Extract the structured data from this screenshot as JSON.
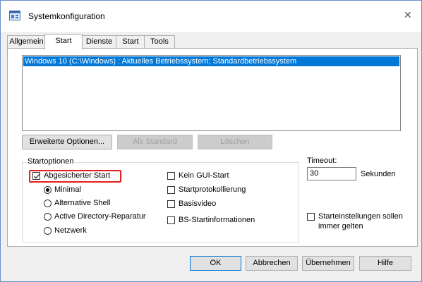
{
  "window": {
    "title": "Systemkonfiguration"
  },
  "icons": {
    "app": "msconfig-icon",
    "close": "close-icon"
  },
  "tabs": [
    {
      "label": "Allgemein",
      "active": false
    },
    {
      "label": "Start",
      "active": true
    },
    {
      "label": "Dienste",
      "active": false
    },
    {
      "label": "Start",
      "active": false
    },
    {
      "label": "Tools",
      "active": false
    }
  ],
  "boot_list": {
    "items": [
      "Windows 10 (C:\\Windows) : Aktuelles Betriebssystem; Standardbetriebssystem"
    ],
    "selected_index": 0
  },
  "boot_buttons": {
    "advanced": "Erweiterte Optionen...",
    "set_default": "Als Standard",
    "delete": "Löschen"
  },
  "boot_options": {
    "group_label": "Startoptionen",
    "safe_boot": {
      "label": "Abgesicherter Start",
      "checked": true
    },
    "radios": [
      {
        "label": "Minimal",
        "selected": true
      },
      {
        "label": "Alternative Shell",
        "selected": false
      },
      {
        "label": "Active Directory-Reparatur",
        "selected": false
      },
      {
        "label": "Netzwerk",
        "selected": false
      }
    ],
    "checks": [
      {
        "label": "Kein GUI-Start",
        "checked": false
      },
      {
        "label": "Startprotokollierung",
        "checked": false
      },
      {
        "label": "Basisvideo",
        "checked": false
      },
      {
        "label": "BS-Startinformationen",
        "checked": false
      }
    ]
  },
  "timeout": {
    "label": "Timeout:",
    "value": "30",
    "unit": "Sekunden"
  },
  "permanent": {
    "label_line1": "Starteinstellungen sollen",
    "label_line2": "immer gelten",
    "checked": false
  },
  "dialog_buttons": {
    "ok": "OK",
    "cancel": "Abbrechen",
    "apply": "Übernehmen",
    "help": "Hilfe"
  },
  "colors": {
    "selection": "#0078d7",
    "highlight_box": "#e0201a",
    "accent": "#0078d7"
  }
}
